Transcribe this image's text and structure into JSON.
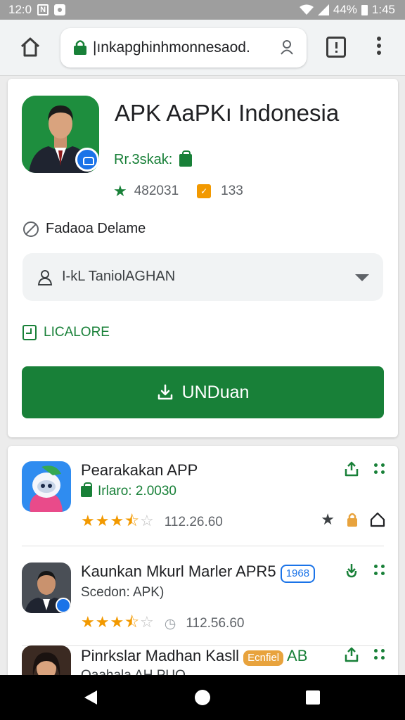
{
  "status_bar": {
    "time": "12:0",
    "battery": "44%",
    "right_time": "1:45"
  },
  "browser": {
    "url": "|ınkapghinhmonnesaod.",
    "home_icon": "home-icon",
    "menu_icon": "more-vert-icon"
  },
  "app": {
    "title": "APK AaPKı Indonesia",
    "price": "Rr.3skak:",
    "rating": "482031",
    "badge_count": "133",
    "developer": "Fadaoa Delame",
    "select_value": "I-kL TaniolAGHAN",
    "license": "LICALORE",
    "download_label": "UNDuan"
  },
  "list": [
    {
      "title": "Pearakakan APP",
      "sub": "Irlaro: 2.0030",
      "rating_value": "112.26.60",
      "stars_full": 3,
      "stars_half": 1,
      "stars_empty": 1
    },
    {
      "title": "Kaunkan Mkurl Marler APR5",
      "pill": "1968",
      "sub": "Scedon: APK)",
      "rating_value": "112.56.60",
      "stars_full": 3,
      "stars_half": 1,
      "stars_empty": 1
    },
    {
      "title": "Pinrkslar Madhan Kasll",
      "pill": "Ecnfiel",
      "title_suffix": "AB",
      "sub": "Oaahala AH.PUO"
    }
  ],
  "colors": {
    "green": "#188038",
    "blue": "#1a73e8",
    "orange": "#f29900",
    "status_bar": "#9e9e9e"
  }
}
